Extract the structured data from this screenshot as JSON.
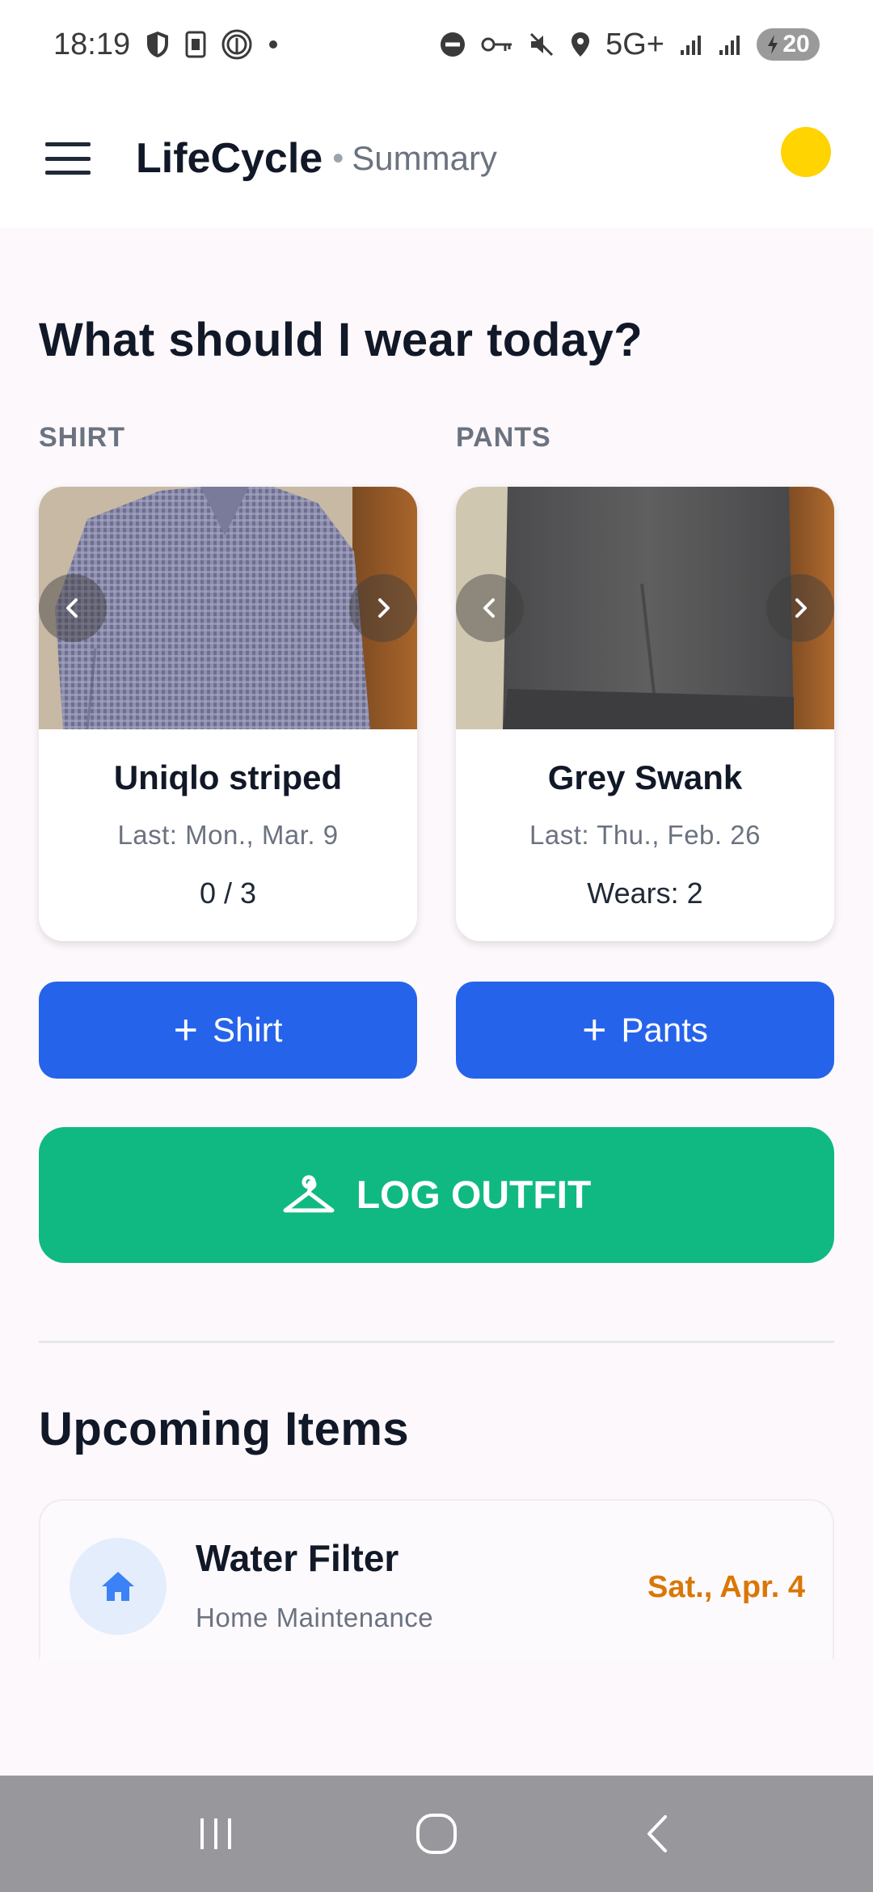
{
  "status_bar": {
    "time": "18:19",
    "network": "5G+",
    "battery": "20"
  },
  "app_bar": {
    "title": "LifeCycle",
    "separator": "•",
    "subtitle": "Summary",
    "avatar_color": "#ffd400"
  },
  "outfit": {
    "heading": "What should I wear today?",
    "shirt": {
      "label": "SHIRT",
      "name": "Uniqlo striped",
      "last": "Last: Mon., Mar. 9",
      "count": "0 / 3",
      "add_label": "Shirt"
    },
    "pants": {
      "label": "PANTS",
      "name": "Grey Swank",
      "last": "Last: Thu., Feb. 26",
      "count": "Wears: 2",
      "add_label": "Pants"
    },
    "log_label": "LOG OUTFIT"
  },
  "upcoming": {
    "title": "Upcoming Items",
    "items": [
      {
        "name": "Water Filter",
        "category": "Home Maintenance",
        "date": "Sat., Apr. 4",
        "icon": "home-icon"
      }
    ]
  },
  "colors": {
    "primary_blue": "#2563eb",
    "log_green": "#10b981",
    "date_orange": "#d97706"
  }
}
